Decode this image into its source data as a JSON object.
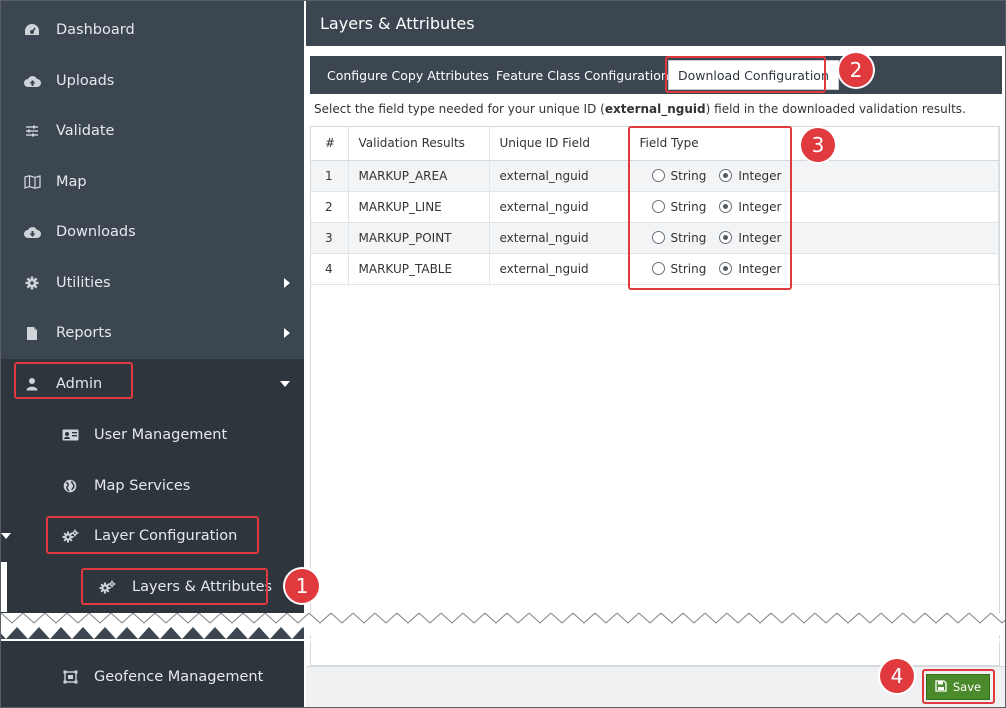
{
  "sidebar": {
    "items": [
      {
        "label": "Dashboard",
        "icon": "dashboard-icon"
      },
      {
        "label": "Uploads",
        "icon": "cloud-upload-icon"
      },
      {
        "label": "Validate",
        "icon": "sliders-icon"
      },
      {
        "label": "Map",
        "icon": "map-icon"
      },
      {
        "label": "Downloads",
        "icon": "cloud-download-icon"
      },
      {
        "label": "Utilities",
        "icon": "gear-icon"
      },
      {
        "label": "Reports",
        "icon": "file-icon"
      },
      {
        "label": "Admin",
        "icon": "user-icon"
      }
    ],
    "admin_sub": [
      {
        "label": "User Management",
        "icon": "id-card-icon"
      },
      {
        "label": "Map Services",
        "icon": "globe-icon"
      },
      {
        "label": "Layer Configuration",
        "icon": "gears-icon"
      }
    ],
    "layer_sub": {
      "label": "Layers & Attributes",
      "icon": "gears-icon"
    },
    "after_tear": {
      "label": "Geofence Management",
      "icon": "geofence-icon"
    }
  },
  "page": {
    "title": "Layers & Attributes",
    "tabs": [
      "Configure Copy Attributes",
      "Feature Class Configuration",
      "Download Configuration"
    ],
    "active_tab": "Download Configuration",
    "instruction_before": "Select the field type needed for your unique ID (",
    "instruction_bold": "external_nguid",
    "instruction_after": ") field in the downloaded validation results."
  },
  "table": {
    "headers": [
      "#",
      "Validation Results",
      "Unique ID Field",
      "Field Type"
    ],
    "rows": [
      {
        "num": "1",
        "result": "MARKUP_AREA",
        "uid": "external_nguid",
        "selected": "Integer"
      },
      {
        "num": "2",
        "result": "MARKUP_LINE",
        "uid": "external_nguid",
        "selected": "Integer"
      },
      {
        "num": "3",
        "result": "MARKUP_POINT",
        "uid": "external_nguid",
        "selected": "Integer"
      },
      {
        "num": "4",
        "result": "MARKUP_TABLE",
        "uid": "external_nguid",
        "selected": "Integer"
      }
    ],
    "options": [
      "String",
      "Integer"
    ]
  },
  "footer": {
    "save_label": "Save"
  },
  "steps": [
    "1",
    "2",
    "3",
    "4"
  ],
  "colors": {
    "sidebar_bg": "#3c4650",
    "highlight": "#e0393e",
    "save_green": "#4a8a2a"
  }
}
